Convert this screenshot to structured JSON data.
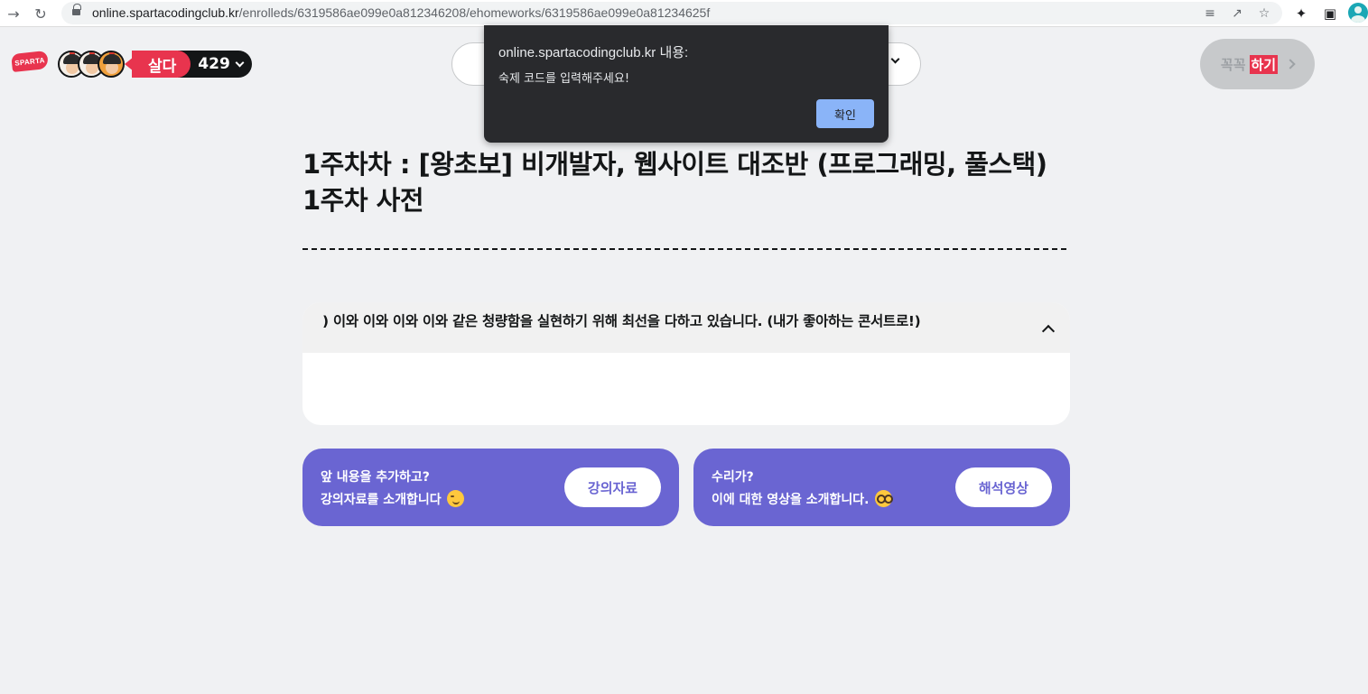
{
  "browser": {
    "url_host": "online.spartacodingclub.kr",
    "url_path": "/enrolleds/6319586ae099e0a812346208/ehomeworks/6319586ae099e0a81234625f"
  },
  "header": {
    "logo_text": "SPARTA",
    "level_name": "살다",
    "points": "429",
    "finish_prefix": "꼭꼭",
    "finish_highlight": "하기"
  },
  "dialog": {
    "title": "online.spartacodingclub.kr 내용:",
    "message": "숙제 코드를 입력해주세요!",
    "ok_label": "확인"
  },
  "main": {
    "title": "1주차차 : [왕초보] 비개발자, 웹사이트 대조반 (프로그래밍, 풀스택) 1주차 사전",
    "card_text": ") 이와 이와 이와 이와 같은 청량함을 실현하기 위해 최선을 다하고 있습니다. (내가 좋아하는 콘서트로!)",
    "promos": [
      {
        "line1": "앞 내용을 추가하고?",
        "line2": "강의자료를 소개합니다",
        "button": "강의자료"
      },
      {
        "line1": "수리가?",
        "line2": "이에 대한 영상을 소개합니다.",
        "button": "해석영상"
      }
    ]
  },
  "colors": {
    "brand_red": "#e8344e",
    "promo_purple": "#6a65d2",
    "dialog_button": "#8ab4f8",
    "background": "#f0f1f3"
  }
}
